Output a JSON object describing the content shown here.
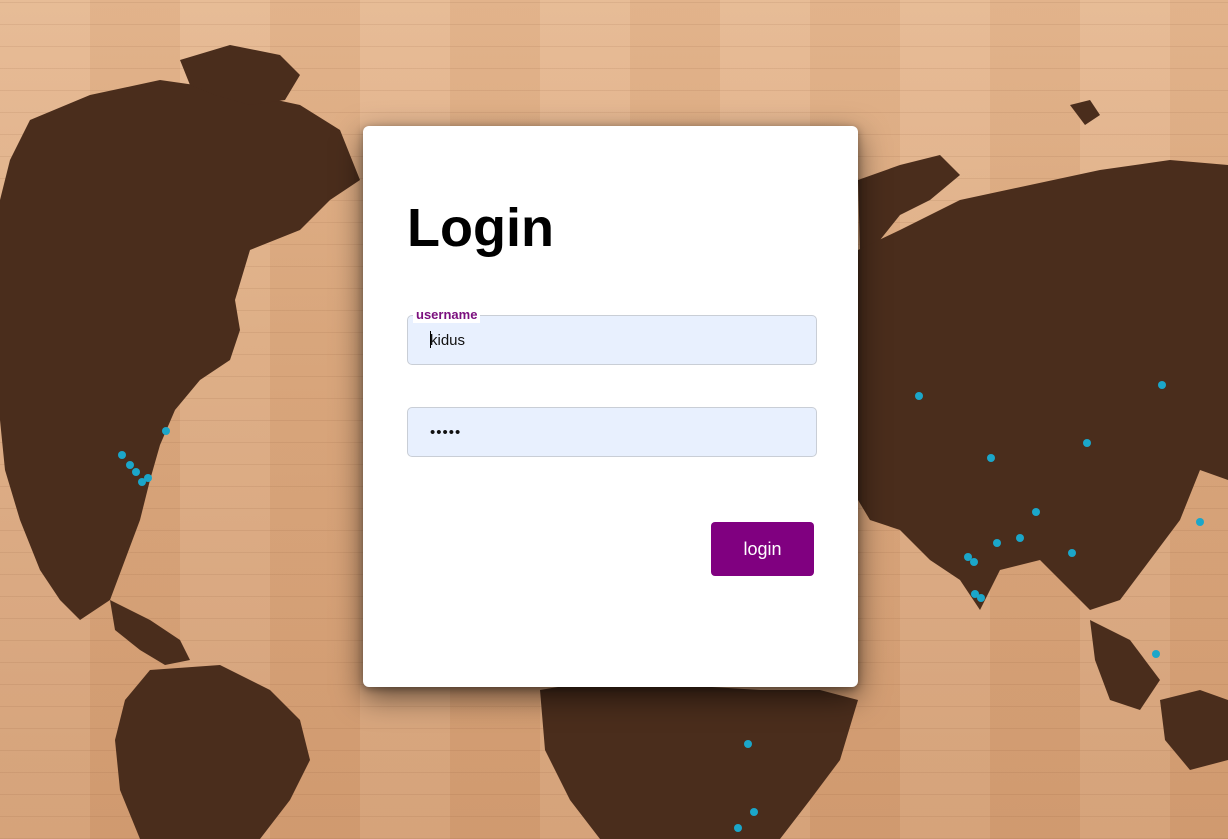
{
  "login_form": {
    "title": "Login",
    "username_label": "username",
    "username_value": "kidus",
    "password_value": "•••••",
    "login_label": "login"
  },
  "colors": {
    "accent": "#800080",
    "label": "#7b0f7e",
    "input_bg": "#e8f0fe",
    "card_bg": "#ffffff",
    "map_land": "#4a2d1c",
    "map_wood": "#dcaa80",
    "pin": "#1ba6c9"
  }
}
